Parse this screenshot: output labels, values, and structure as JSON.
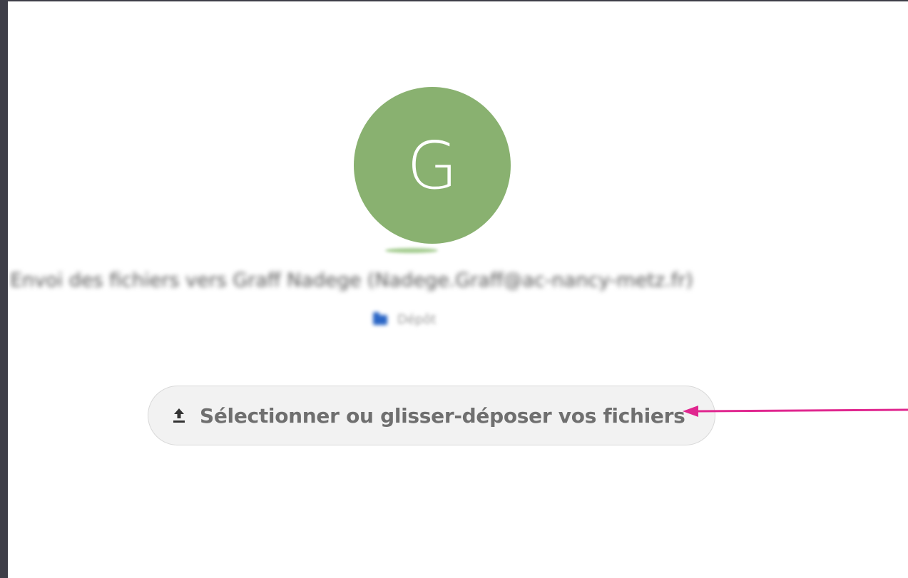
{
  "avatar": {
    "letter": "G",
    "color": "#89b170"
  },
  "recipient": {
    "text": "Envoi des fichiers vers Graff Nadege (Nadege.Graff@ac-nancy-metz.fr)"
  },
  "folder": {
    "icon": "folder-icon",
    "label": "Dépôt"
  },
  "upload": {
    "icon": "upload-icon",
    "label": "Sélectionner ou glisser-déposer vos fichiers"
  },
  "annotation": {
    "color": "#e0278f"
  }
}
